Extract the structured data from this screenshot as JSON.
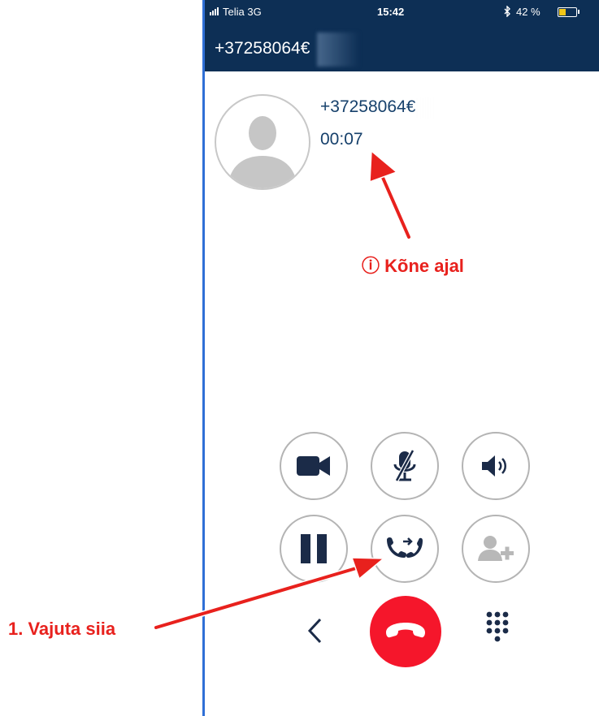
{
  "status_bar": {
    "carrier": "Telia  3G",
    "time": "15:42",
    "bluetooth_icon": "bluetooth-icon",
    "battery_percent": "42 %",
    "battery_level": 0.42,
    "battery_color": "#f2c617"
  },
  "header": {
    "title": "+37258064€"
  },
  "call": {
    "number": "+37258064€",
    "duration": "00:07"
  },
  "controls": {
    "row1": [
      "video-camera-icon",
      "microphone-muted-icon",
      "speaker-icon"
    ],
    "row2": [
      "pause-icon",
      "call-transfer-icon",
      "add-participant-icon"
    ],
    "bottom": [
      "back-chevron-icon",
      "hang-up-icon",
      "dialpad-icon"
    ]
  },
  "annotations": {
    "during_call": "ⓘ Kõne ajal",
    "step1": "1. Vajuta siia"
  },
  "colors": {
    "header_bg": "#0d2f55",
    "text_navy": "#16406b",
    "hangup_red": "#f5162b",
    "annotation_red": "#e8211d",
    "icon_dark": "#1b2b48"
  }
}
